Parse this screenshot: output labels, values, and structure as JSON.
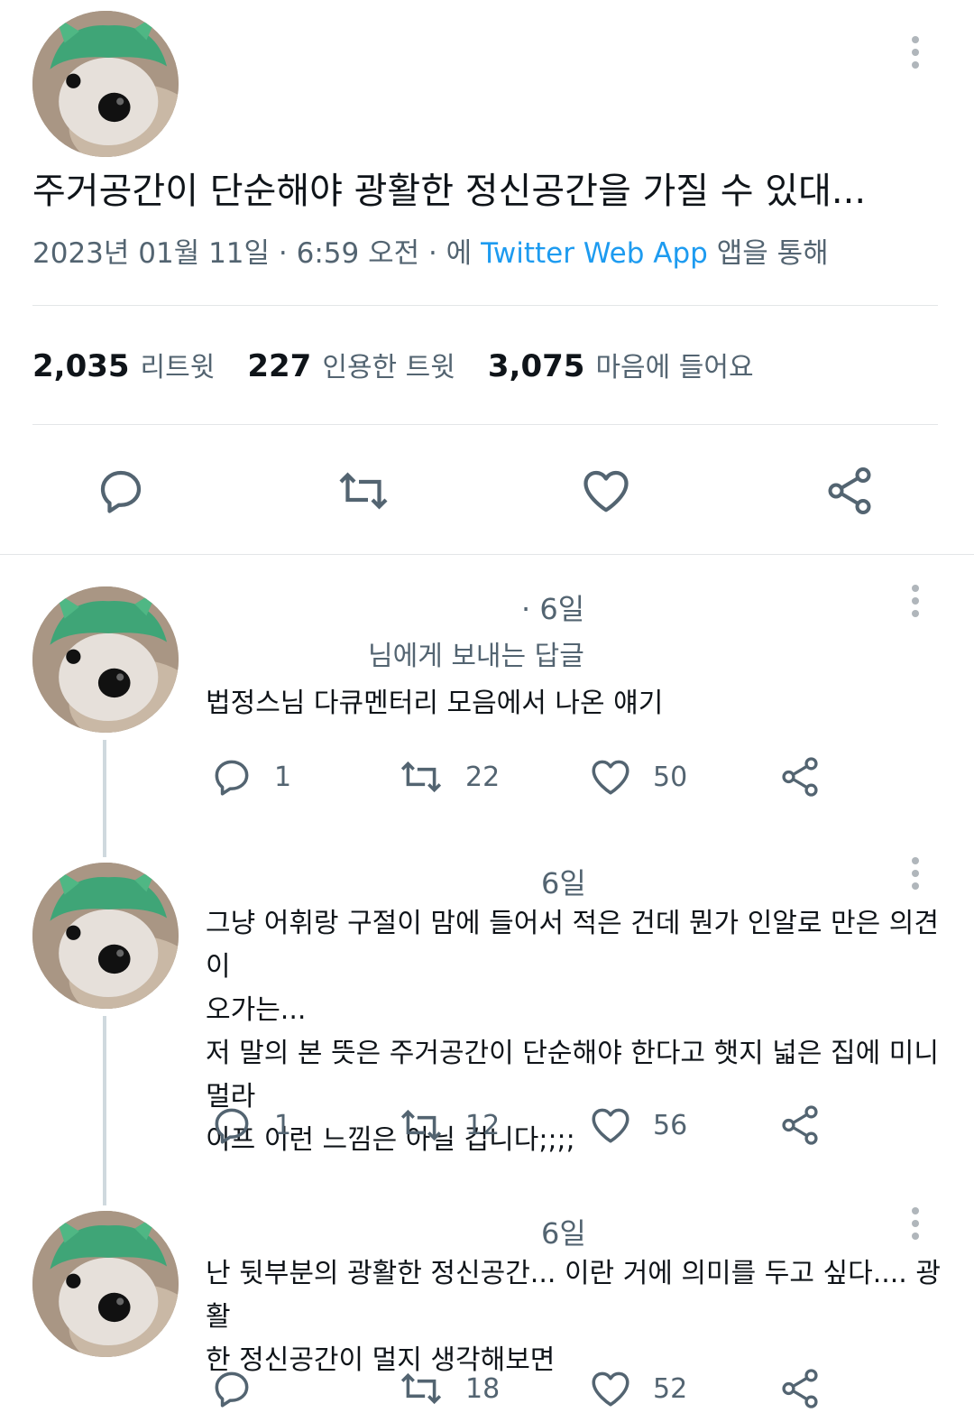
{
  "tweet": {
    "text": "주거공간이 단순해야 광활한 정신공간을 가질 수 있대...",
    "date": "2023년 01월 11일 · 6:59 오전 · 에",
    "source": "Twitter Web App",
    "source_suffix": "앱을 통해",
    "stats": [
      {
        "num": "2,035",
        "label": "리트윗"
      },
      {
        "num": "227",
        "label": "인용한 트윗"
      },
      {
        "num": "3,075",
        "label": "마음에 들어요"
      }
    ]
  },
  "replies": [
    {
      "time": "· 6일",
      "reply_to": "님에게 보내는 답글",
      "text": "법정스님 다큐멘터리 모음에서 나온 얘기",
      "comments": "1",
      "retweets": "22",
      "likes": "50"
    },
    {
      "time": "6일",
      "lines": [
        "그냥 어휘랑 구절이 맘에 들어서 적은 건데 뭔가 인알로 만은 의견이",
        "오가는...",
        "저 말의 본 뜻은 주거공간이 단순해야 한다고 햇지 넓은 집에 미니멀라",
        "이프 이런 느낌은 아닐 겁니다;;;;"
      ],
      "comments": "1",
      "retweets": "12",
      "likes": "56"
    },
    {
      "time": "6일",
      "lines": [
        "난 뒷부분의 광활한 정신공간... 이란 거에 의미를 두고 싶다.... 광활",
        "한 정신공간이 멀지 생각해보면"
      ],
      "comments": "",
      "retweets": "18",
      "likes": "52"
    }
  ],
  "colors": {
    "link": "#1d9bf0",
    "muted": "#536471",
    "text": "#0f1419"
  }
}
